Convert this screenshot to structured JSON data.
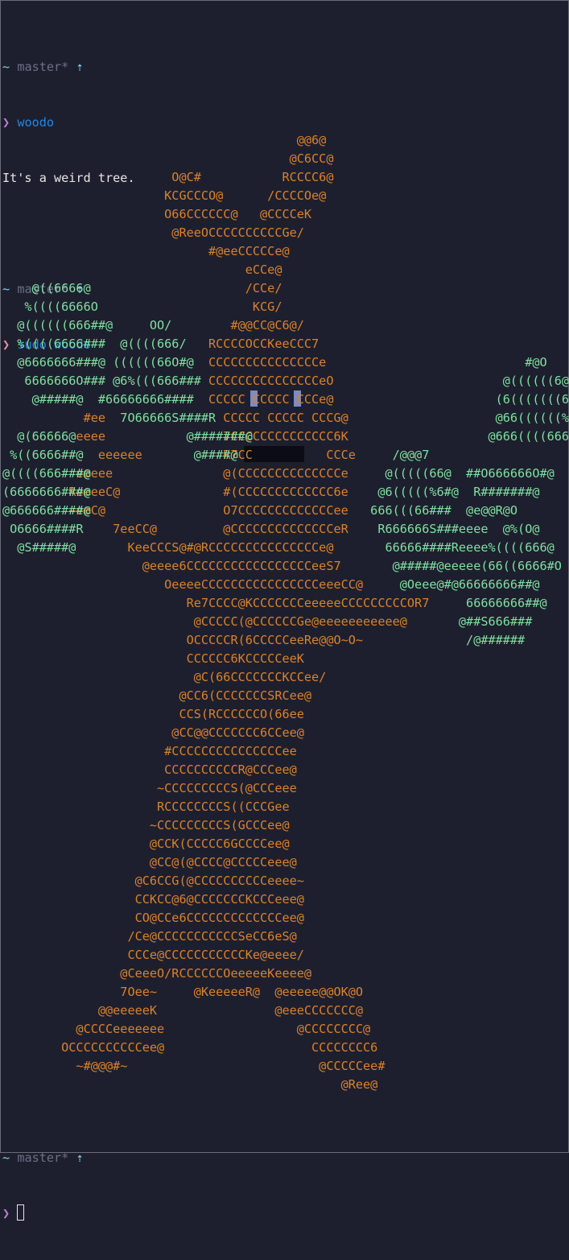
{
  "terminal": {
    "lines": [
      {
        "type": "prompt",
        "tilde": "~",
        "branch": "master*",
        "arrow": "⇡"
      },
      {
        "type": "cmd",
        "symbol": "❯",
        "command": "woodo"
      },
      {
        "type": "output",
        "text": "It's a weird tree."
      },
      {
        "type": "blank"
      },
      {
        "type": "prompt",
        "tilde": "~",
        "branch": "master*",
        "arrow": "⇡"
      },
      {
        "type": "cmd",
        "symbol": "❯",
        "command": "sudo woodo"
      }
    ],
    "final_prompt": {
      "tilde": "~",
      "branch": "master*",
      "arrow": "⇡",
      "symbol": "❯"
    }
  },
  "art": {
    "orange": "                                        @@6@\n                                       @C6CC@\n                       O@C#           RCCCC6@\n                      KCGCCCO@      /CCCCOe@\n                      O66CCCCCC@   @CCCCeK\n                       @ReeOCCCCCCCCCCGe/\n                            #@eeCCCCCe@\n                                 eCCe@\n                                 /CCe/\n                                  KCG/\n                               #@@CC@C6@/\n                            RCCCCOCCKeeCCC7\n                            CCCCCCCCCCCCCCCe\n                            CCCCCCCCCCCCCCCeO\n                            CCCCC CCCCC CCCe@\n           #ee                CCCCC CCCCC CCCG@\n          eeee                7CCCCCCCCCCCCCC6K\n             eeeeee           R7CC          CCCe\n          eeeee               @(CCCCCCCCCCCCCCe\n         ReeeeC@              #(CCCCCCCCCCCCC6e\n         ~eeC@                O7CCCCCCCCCCCCCee\n               7eeCC@         @CCCCCCCCCCCCCCeR\n                 KeeCCCS@#@RCCCCCCCCCCCCCCCe@\n                   @eeee6CCCCCCCCCCCCCCCCCeeS7\n                      OeeeeCCCCCCCCCCCCCCCCeeeCC@\n                         Re7CCCC@KCCCCCCCeeeeeCCCCCCCCCOR7\n                          @CCCCC(@CCCCCCGe@eeeeeeeeeee@\n                         OCCCCCR(6CCCCCeeRe@@O~O~\n                         CCCCCC6KCCCCCeeK\n                          @C(66CCCCCCCKCCee/\n                        @CC6(CCCCCCCSRCee@\n                        CCS(RCCCCCCO(66ee\n                       @CC@@CCCCCCC6CCee@\n                      #CCCCCCCCCCCCCCCee\n                      CCCCCCCCCCR@CCCee@\n                     ~CCCCCCCCCS(@CCCeee\n                     RCCCCCCCCS((CCCGee\n                    ~CCCCCCCCCS(GCCCee@\n                    @CCK(CCCCC6GCCCCee@\n                    @CC@(@CCCC@CCCCCeee@\n                  @C6CCG(@CCCCCCCCCCeeee~\n                  CCKCC@6@CCCCCCCKCCCeee@\n                  CO@CCe6CCCCCCCCCCCCCee@\n                 /Ce@CCCCCCCCCCCSeCC6eS@\n                 CCCe@CCCCCCCCCCCKe@eeee/\n                @CeeeO/RCCCCCCOeeeeeKeeee@\n                7Oee~     @KeeeeeR@  @eeeee@@OK@O\n             @@eeeeeK                @eeeCCCCCCC@\n          @CCCCeeeeeee                  @CCCCCCCC@\n        OCCCCCCCCCCee@                    CCCCCCCC6\n          ~#@@@#~                          @CCCCCee#\n                                              @Ree@",
    "green": "\n\n\n\n\n\n\n\n    @((6666@\n   %((((6666O\n  @((((((666##@     OO/\n  %((((6666###  @((((666/\n  @6666666###@ ((((((66O#@                                             #@O\n   6666666O### @6%(((666###                                         @((((((6@\n    @#####@  #66666666####                                         (6(((((((6@\n                7O66666S####R                                      @66((((((%66~\n  @(66666@               @#######@                                @666((((666#O\n %((6666##@               @####@                     /@@@7        \n@((((666###@                                        @(((((66@  ##O666666O#@\n(6666666###@                                       @6(((((%6#@  R#######@\n@666666####@                                      666(((66###  @e@@R@O\n O6666####R                                        R666666S###eeee  @%(O@\n  @S#####@                                          66666####Reeee%((((666@\n                                                     @#####@eeeee(66((6666#O\n                                                      @Oeee@#@66666666##@\n                                                               66666666##@\n                                                              @##S666###\n                                                               /@######"
  }
}
